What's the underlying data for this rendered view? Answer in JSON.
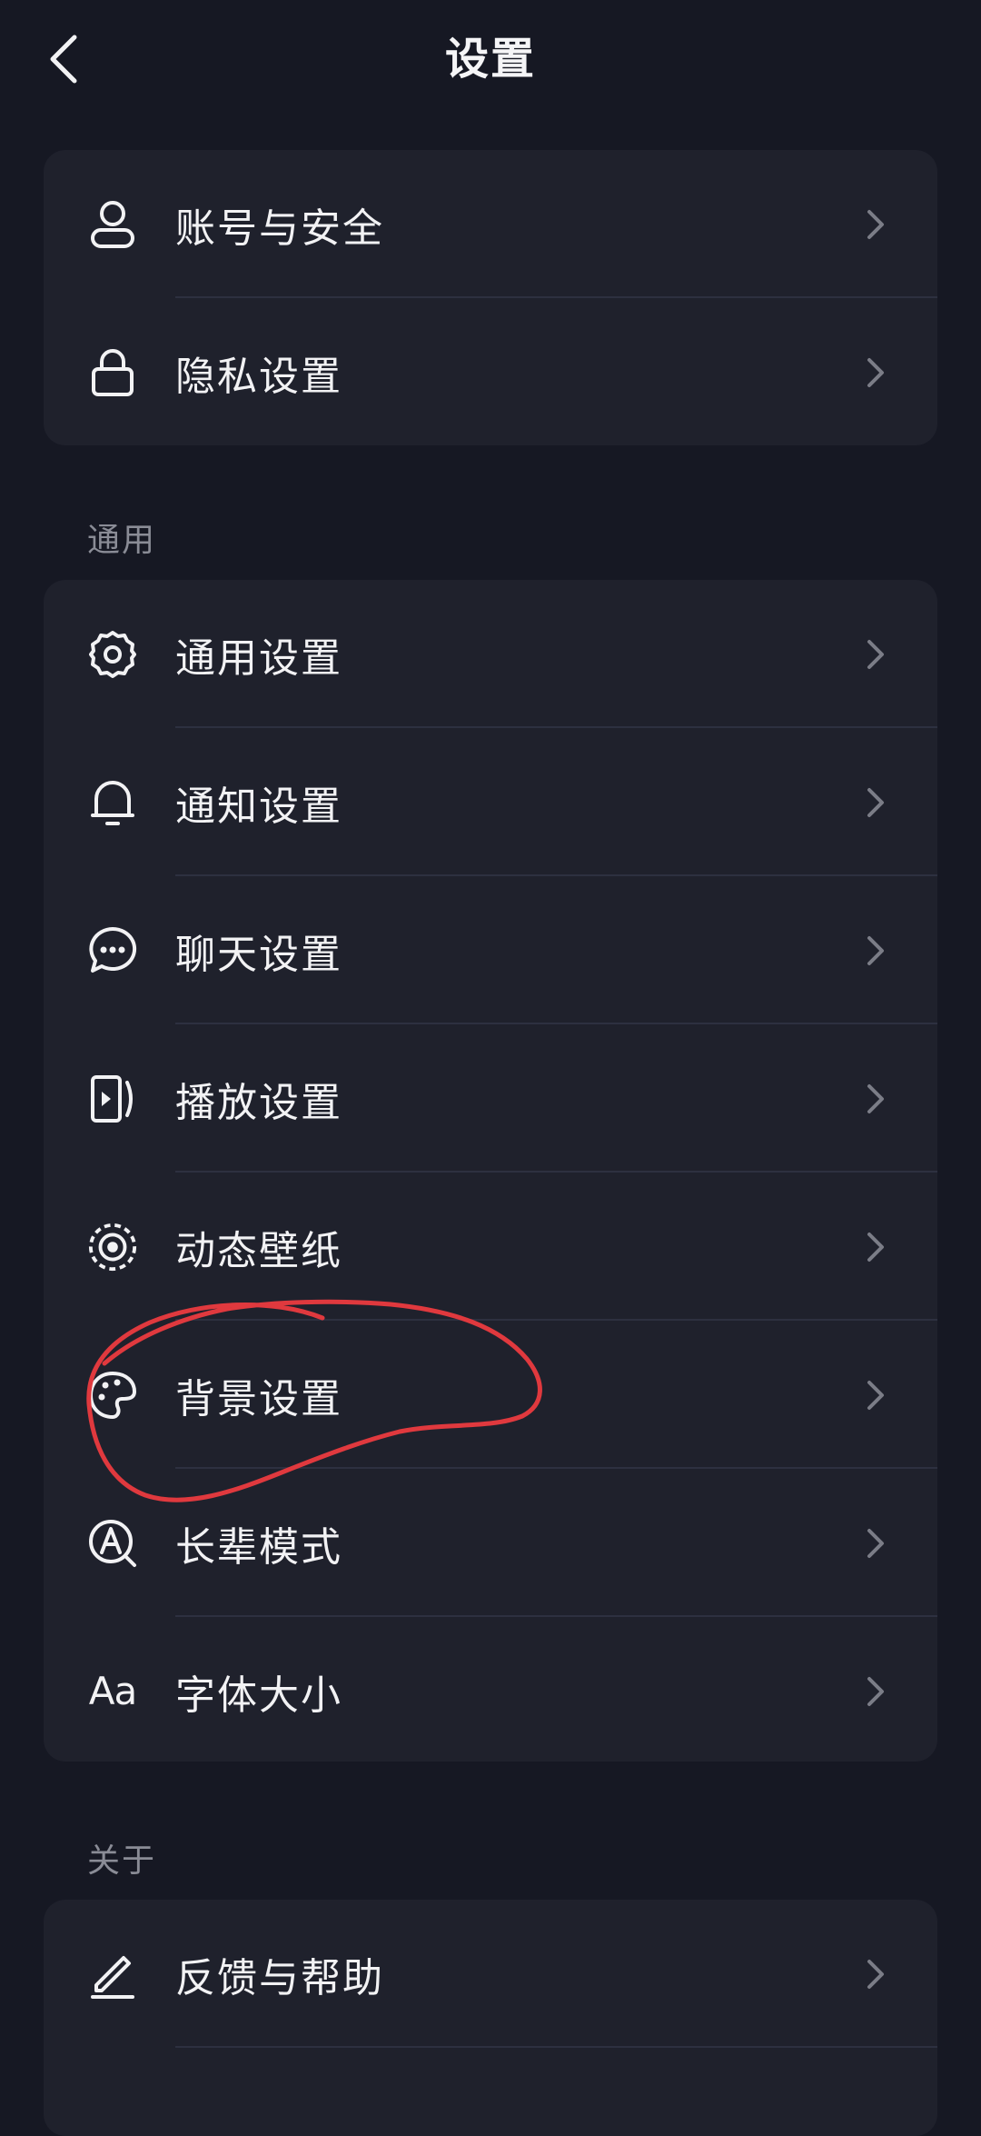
{
  "header": {
    "title": "设置",
    "back_icon": "chevron-left-icon"
  },
  "account_card": {
    "items": [
      {
        "label": "账号与安全",
        "icon": "user-icon"
      },
      {
        "label": "隐私设置",
        "icon": "lock-icon"
      }
    ]
  },
  "general_section": {
    "title": "通用",
    "items": [
      {
        "label": "通用设置",
        "icon": "gear-icon"
      },
      {
        "label": "通知设置",
        "icon": "bell-icon"
      },
      {
        "label": "聊天设置",
        "icon": "chat-bubble-icon"
      },
      {
        "label": "播放设置",
        "icon": "play-mode-icon"
      },
      {
        "label": "动态壁纸",
        "icon": "dynamic-wallpaper-icon"
      },
      {
        "label": "背景设置",
        "icon": "palette-icon"
      },
      {
        "label": "长辈模式",
        "icon": "elder-mode-icon"
      },
      {
        "label": "字体大小",
        "icon": "font-size-icon",
        "glyph": "Aa"
      }
    ]
  },
  "about_section": {
    "title": "关于",
    "items": [
      {
        "label": "反馈与帮助",
        "icon": "edit-pen-icon"
      }
    ]
  },
  "colors": {
    "background": "#161823",
    "card": "#1f212c",
    "divider": "#2d3040",
    "annotation": "#e0393e"
  }
}
